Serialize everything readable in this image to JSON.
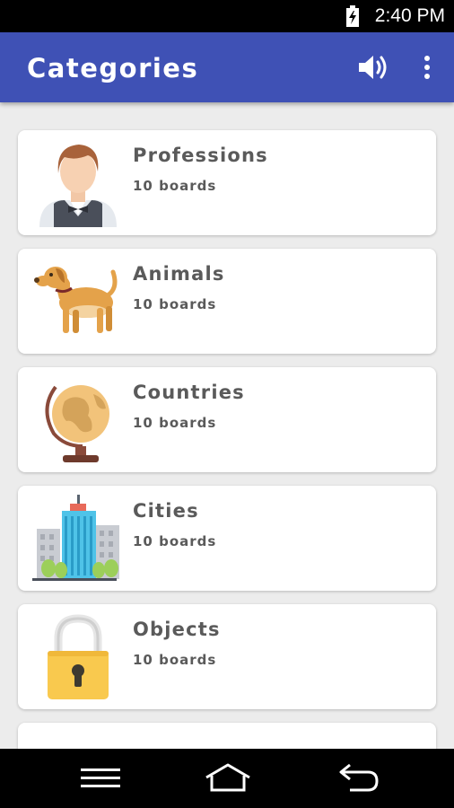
{
  "status_bar": {
    "time": "2:40 PM"
  },
  "app_bar": {
    "title": "Categories",
    "icons": [
      "volume-icon",
      "more-vert-icon"
    ]
  },
  "categories": [
    {
      "name": "Professions",
      "count": "10 boards",
      "icon": "waiter-icon"
    },
    {
      "name": "Animals",
      "count": "10 boards",
      "icon": "dog-icon"
    },
    {
      "name": "Countries",
      "count": "10 boards",
      "icon": "globe-icon"
    },
    {
      "name": "Cities",
      "count": "10 boards",
      "icon": "city-icon"
    },
    {
      "name": "Objects",
      "count": "10 boards",
      "icon": "padlock-icon"
    }
  ],
  "nav_bar": {
    "icons": [
      "menu-icon",
      "home-icon",
      "back-icon"
    ]
  },
  "colors": {
    "app_bar": "#3f51b5",
    "background": "#ececec",
    "text": "#5a5a5a"
  }
}
